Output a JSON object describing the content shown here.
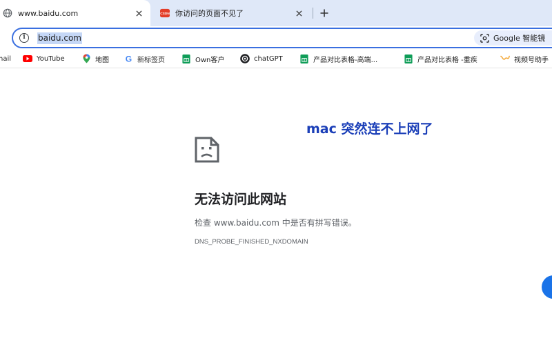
{
  "tabs": [
    {
      "title": "www.baidu.com",
      "icon": "globe-icon",
      "active": true
    },
    {
      "title": "你访问的页面不见了",
      "icon": "csdn-icon",
      "active": false,
      "icon_color": "#e33d28"
    }
  ],
  "omnibox": {
    "url": "baidu.com",
    "lens_label": "Google 智能镜"
  },
  "bookmarks": [
    {
      "label": "nail",
      "icon": "gmail-icon"
    },
    {
      "label": "YouTube",
      "icon": "youtube-icon"
    },
    {
      "label": "地图",
      "icon": "maps-icon"
    },
    {
      "label": "新标签页",
      "icon": "google-icon"
    },
    {
      "label": "Own客户",
      "icon": "sheets-icon"
    },
    {
      "label": "chatGPT",
      "icon": "chatgpt-icon"
    },
    {
      "label": "产品对比表格-高端...",
      "icon": "sheets-icon"
    },
    {
      "label": "产品对比表格 -重疾",
      "icon": "sheets-icon"
    },
    {
      "label": "视频号助手",
      "icon": "wechat-channels-icon"
    }
  ],
  "error_page": {
    "annotation": "mac 突然连不上网了",
    "title": "无法访问此网站",
    "description": "检查 www.baidu.com 中是否有拼写错误。",
    "code": "DNS_PROBE_FINISHED_NXDOMAIN"
  },
  "colors": {
    "tab_strip": "#dfe8f8",
    "accent": "#3a6fe0",
    "annotation": "#1b3fb8"
  }
}
